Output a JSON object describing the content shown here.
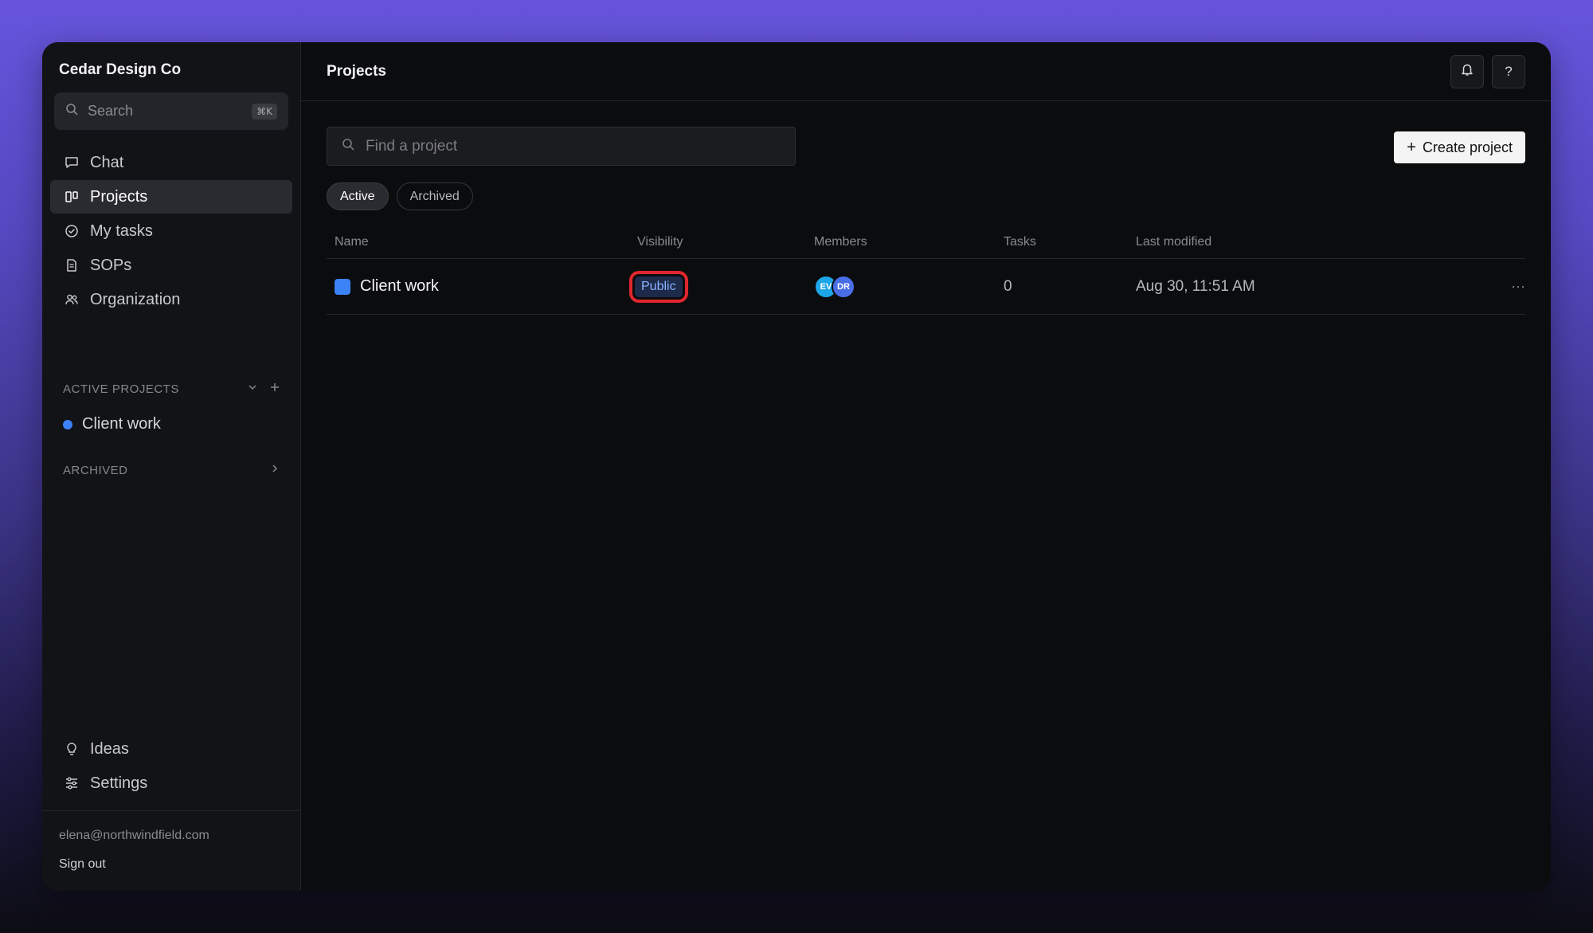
{
  "workspace": {
    "name": "Cedar Design Co"
  },
  "sidebar": {
    "search": {
      "placeholder": "Search",
      "shortcut": "⌘K"
    },
    "nav": [
      {
        "label": "Chat",
        "icon": "chat-icon"
      },
      {
        "label": "Projects",
        "icon": "projects-icon",
        "active": true
      },
      {
        "label": "My tasks",
        "icon": "check-circle-icon"
      },
      {
        "label": "SOPs",
        "icon": "document-icon"
      },
      {
        "label": "Organization",
        "icon": "users-icon"
      }
    ],
    "active_projects": {
      "label": "ACTIVE PROJECTS",
      "items": [
        {
          "label": "Client work",
          "color": "#3b82f6"
        }
      ]
    },
    "archived": {
      "label": "ARCHIVED"
    },
    "bottom_nav": [
      {
        "label": "Ideas",
        "icon": "lightbulb-icon"
      },
      {
        "label": "Settings",
        "icon": "sliders-icon"
      }
    ],
    "footer": {
      "email": "elena@northwindfield.com",
      "sign_out": "Sign out"
    }
  },
  "main": {
    "title": "Projects",
    "find": {
      "placeholder": "Find a project"
    },
    "create_label": "Create project",
    "tabs": [
      {
        "label": "Active",
        "active": true
      },
      {
        "label": "Archived"
      }
    ],
    "table": {
      "columns": [
        "Name",
        "Visibility",
        "Members",
        "Tasks",
        "Last modified"
      ],
      "rows": [
        {
          "name": "Client work",
          "color": "#3b82f6",
          "visibility": "Public",
          "members": [
            "EV",
            "DR"
          ],
          "tasks": "0",
          "last_modified": "Aug 30, 11:51 AM"
        }
      ]
    }
  },
  "colors": {
    "accent": "#3b82f6",
    "highlight": "#e0262d",
    "background_top": "#6655dc"
  }
}
